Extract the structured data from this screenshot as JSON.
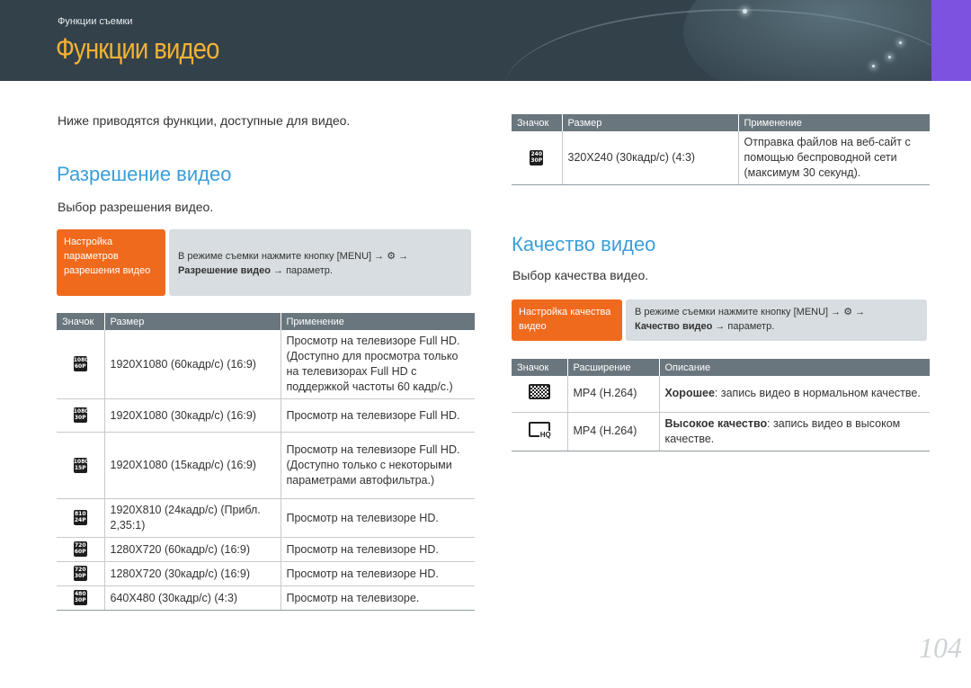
{
  "header": {
    "breadcrumb": "Функции съемки",
    "title": "Функции видео"
  },
  "intro": "Ниже приводятся функции, доступные для видео.",
  "resolution": {
    "heading": "Разрешение видео",
    "subtitle": "Выбор разрешения видео.",
    "step_label": "Настройка параметров разрешения видео",
    "step_line1": "В режиме съемки нажмите кнопку [MENU] → ⚙ →",
    "step_bold": "Разрешение видео",
    "step_tail": " → параметр.",
    "columns": [
      "Значок",
      "Размер",
      "Применение"
    ],
    "rows": [
      {
        "icon": [
          "1080",
          "60P"
        ],
        "size": "1920X1080 (60кадр/с) (16:9)",
        "usage": "Просмотр на телевизоре Full HD. (Доступно для просмотра только на телевизорах Full HD с поддержкой частоты 60 кадр/с.)"
      },
      {
        "icon": [
          "1080",
          "30P"
        ],
        "size": "1920X1080 (30кадр/с) (16:9)",
        "usage": "Просмотр на телевизоре Full HD."
      },
      {
        "icon": [
          "1080",
          "15P"
        ],
        "size": "1920X1080 (15кадр/с) (16:9)",
        "usage": "Просмотр на телевизоре Full HD. (Доступно только с некоторыми параметрами автофильтра.)"
      },
      {
        "icon": [
          "810",
          "24P"
        ],
        "size": "1920X810 (24кадр/с) (Прибл. 2,35:1)",
        "usage": "Просмотр на телевизоре HD."
      },
      {
        "icon": [
          "720",
          "60P"
        ],
        "size": "1280X720 (60кадр/с) (16:9)",
        "usage": "Просмотр на телевизоре HD."
      },
      {
        "icon": [
          "720",
          "30P"
        ],
        "size": "1280X720 (30кадр/с) (16:9)",
        "usage": "Просмотр на телевизоре HD."
      },
      {
        "icon": [
          "480",
          "30P"
        ],
        "size": "640X480 (30кадр/с) (4:3)",
        "usage": "Просмотр на телевизоре."
      }
    ]
  },
  "res_continued": {
    "columns": [
      "Значок",
      "Размер",
      "Применение"
    ],
    "rows": [
      {
        "icon": [
          "240",
          "30P"
        ],
        "size": "320X240 (30кадр/с) (4:3)",
        "usage": "Отправка файлов на веб-сайт с помощью беспроводной сети (максимум 30 секунд)."
      }
    ]
  },
  "quality": {
    "heading": "Качество видео",
    "subtitle": "Выбор качества видео.",
    "step_label": "Настройка качества видео",
    "step_line1": "В режиме съемки нажмите кнопку [MENU] → ⚙ →",
    "step_bold": "Качество видео",
    "step_tail": " → параметр.",
    "columns": [
      "Значок",
      "Расширение",
      "Описание"
    ],
    "rows": [
      {
        "icon": "normal-quality-icon",
        "ext": "MP4 (H.264)",
        "bold": "Хорошее",
        "desc": ": запись видео в нормальном качестве."
      },
      {
        "icon": "high-quality-icon",
        "ext": "MP4 (H.264)",
        "bold": "Высокое качество",
        "desc": ": запись видео в высоком качестве."
      }
    ]
  },
  "page_number": "104"
}
